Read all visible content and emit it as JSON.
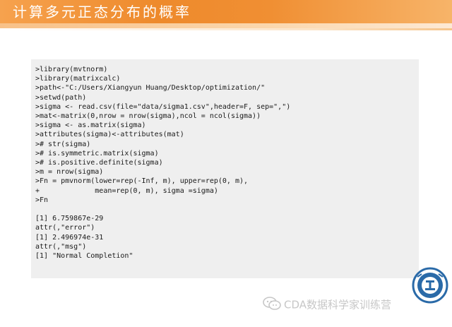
{
  "header": {
    "title": "计算多元正态分布的概率"
  },
  "code": {
    "lines": [
      ">library(mvtnorm)",
      ">library(matrixcalc)",
      ">path<-\"C:/Users/Xiangyun Huang/Desktop/optimization/\"",
      ">setwd(path)",
      ">sigma <- read.csv(file=\"data/sigma1.csv\",header=F, sep=\",\")",
      ">mat<-matrix(0,nrow = nrow(sigma),ncol = ncol(sigma))",
      ">sigma <- as.matrix(sigma)",
      ">attributes(sigma)<-attributes(mat)",
      "># str(sigma)",
      "># is.symmetric.matrix(sigma)",
      "># is.positive.definite(sigma)",
      ">m = nrow(sigma)",
      ">Fn = pmvnorm(lower=rep(-Inf, m), upper=rep(0, m),",
      "+             mean=rep(0, m), sigma =sigma)",
      ">Fn"
    ],
    "output": [
      "[1] 6.759867e-29",
      "attr(,\"error\")",
      "[1] 2.496974e-31",
      "attr(,\"msg\")",
      "[1] \"Normal Completion\""
    ]
  },
  "footer": {
    "watermark": "CDA数据科学家训练营"
  },
  "colors": {
    "title_bar": "#ee8a2c",
    "code_bg": "#efefef",
    "keyword": "#8a2bb6",
    "string": "#c8255e"
  }
}
